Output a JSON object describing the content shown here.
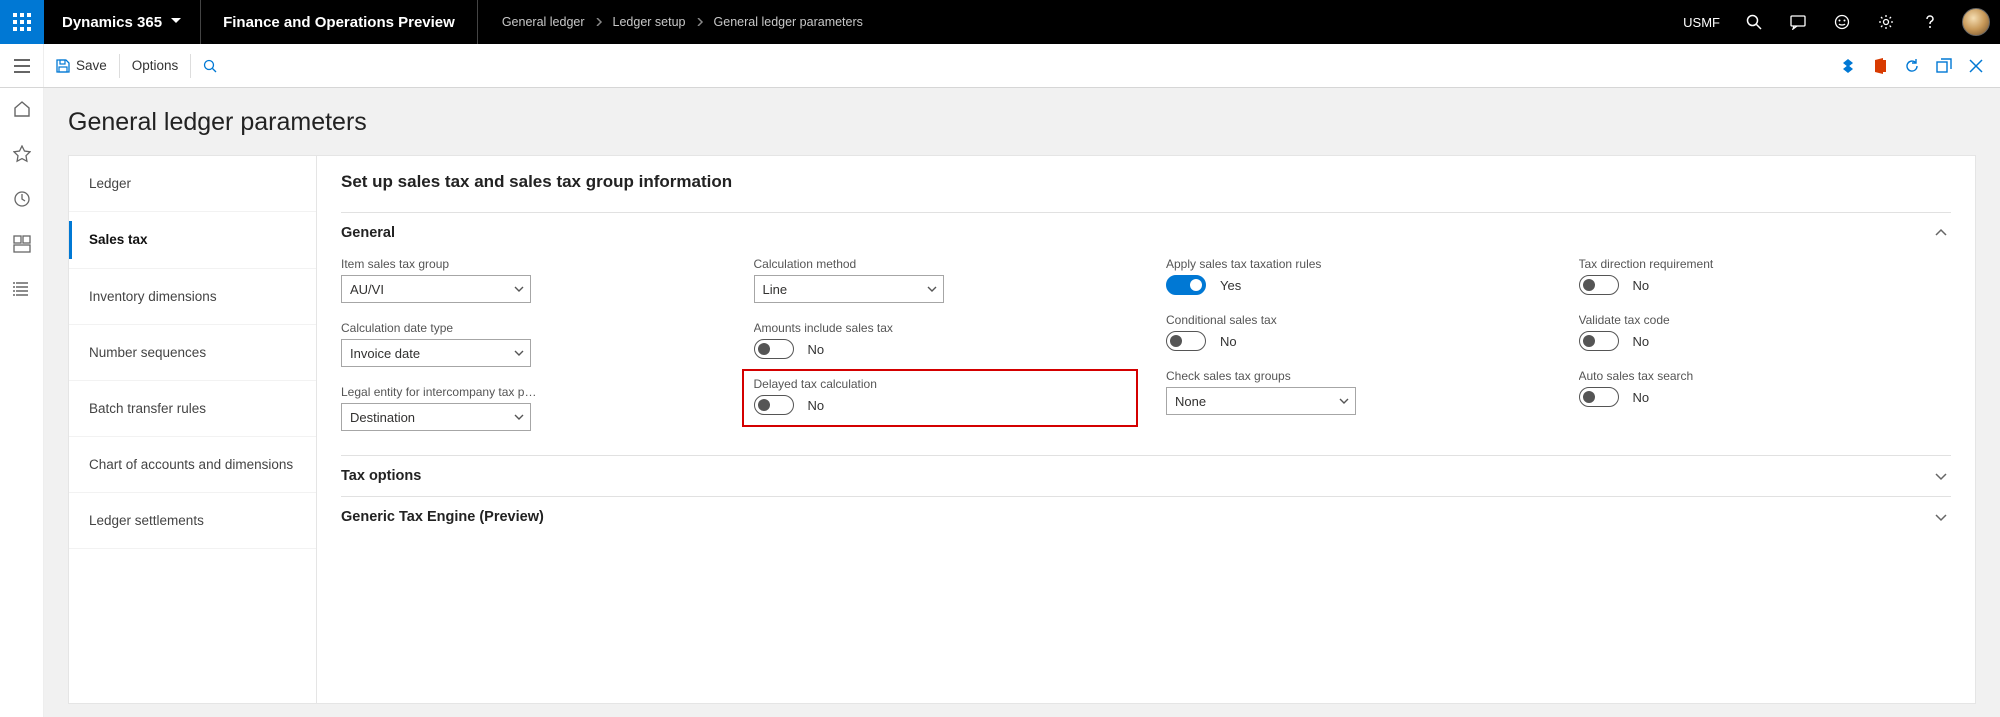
{
  "topbar": {
    "brand": "Dynamics 365",
    "environment": "Finance and Operations Preview",
    "breadcrumb": [
      "General ledger",
      "Ledger setup",
      "General ledger parameters"
    ],
    "company": "USMF"
  },
  "ribbon": {
    "save": "Save",
    "options": "Options"
  },
  "page": {
    "title": "General ledger parameters",
    "section_title": "Set up sales tax and sales tax group information"
  },
  "sidenav": [
    "Ledger",
    "Sales tax",
    "Inventory dimensions",
    "Number sequences",
    "Batch transfer rules",
    "Chart of accounts and dimensions",
    "Ledger settlements"
  ],
  "groups": {
    "general_label": "General",
    "tax_options_label": "Tax options",
    "generic_engine_label": "Generic Tax Engine (Preview)"
  },
  "fields": {
    "item_sales_tax_group": {
      "label": "Item sales tax group",
      "value": "AU/VI"
    },
    "calc_date_type": {
      "label": "Calculation date type",
      "value": "Invoice date"
    },
    "legal_entity": {
      "label": "Legal entity for intercompany tax post...",
      "value": "Destination"
    },
    "calc_method": {
      "label": "Calculation method",
      "value": "Line"
    },
    "amounts_include": {
      "label": "Amounts include sales tax",
      "value": "No",
      "on": false
    },
    "delayed_tax": {
      "label": "Delayed tax calculation",
      "value": "No",
      "on": false
    },
    "apply_rules": {
      "label": "Apply sales tax taxation rules",
      "value": "Yes",
      "on": true
    },
    "conditional": {
      "label": "Conditional sales tax",
      "value": "No",
      "on": false
    },
    "check_groups": {
      "label": "Check sales tax groups",
      "value": "None"
    },
    "tax_dir_req": {
      "label": "Tax direction requirement",
      "value": "No",
      "on": false
    },
    "validate_tax": {
      "label": "Validate tax code",
      "value": "No",
      "on": false
    },
    "auto_search": {
      "label": "Auto sales tax search",
      "value": "No",
      "on": false
    }
  }
}
